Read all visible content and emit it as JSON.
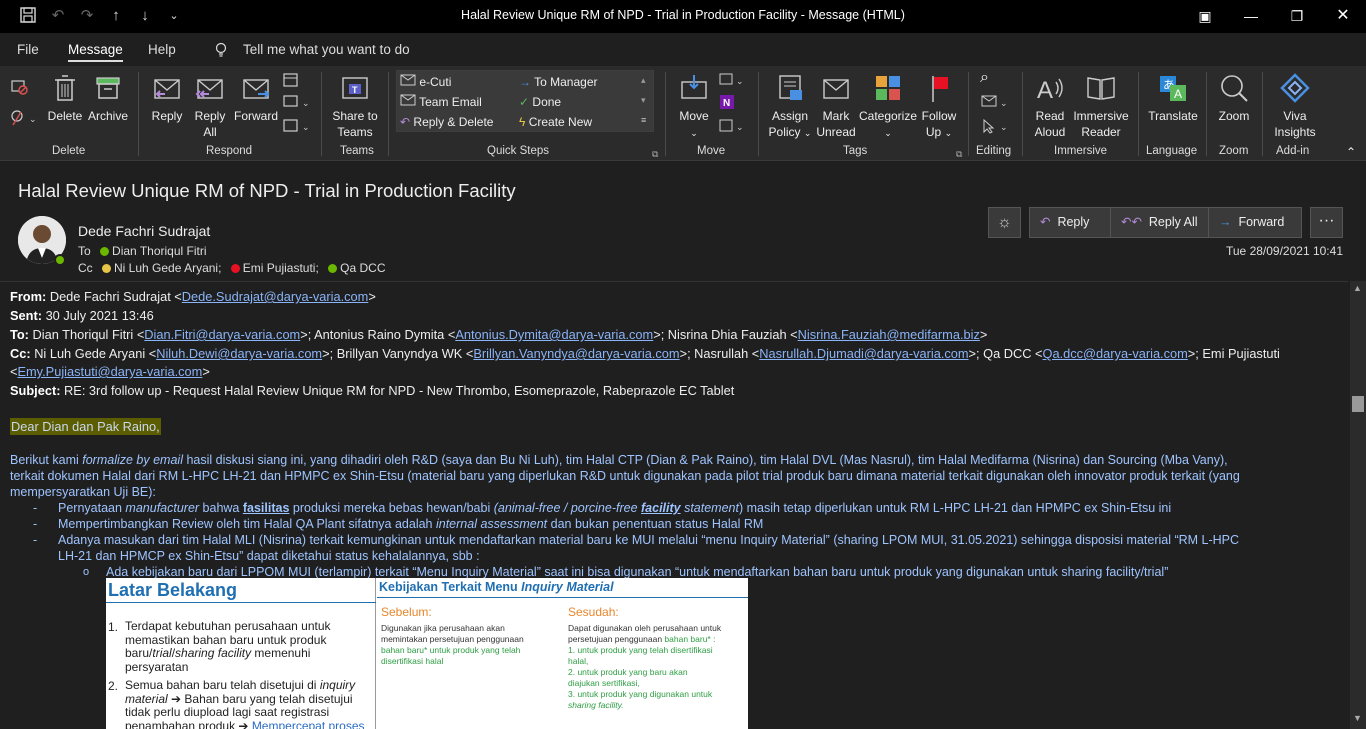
{
  "window": {
    "title": "Halal Review Unique RM of NPD - Trial in Production Facility  -  Message (HTML)"
  },
  "menu": {
    "file": "File",
    "message": "Message",
    "help": "Help",
    "tellme": "Tell me what you want to do"
  },
  "ribbon": {
    "delete_group": {
      "label": "Delete",
      "delete": "Delete",
      "archive": "Archive"
    },
    "respond_group": {
      "label": "Respond",
      "reply": "Reply",
      "reply_all_1": "Reply",
      "reply_all_2": "All",
      "forward": "Forward"
    },
    "teams_group": {
      "label": "Teams",
      "share_1": "Share to",
      "share_2": "Teams"
    },
    "quicksteps_group": {
      "label": "Quick Steps",
      "items": [
        "e-Cuti",
        "To Manager",
        "Team Email",
        "Done",
        "Reply & Delete",
        "Create New"
      ]
    },
    "move_group": {
      "label": "Move",
      "move": "Move"
    },
    "tags_group": {
      "label": "Tags",
      "assign_1": "Assign",
      "assign_2": "Policy",
      "mark_1": "Mark",
      "mark_2": "Unread",
      "categorize": "Categorize",
      "follow_1": "Follow",
      "follow_2": "Up"
    },
    "editing_group": {
      "label": "Editing"
    },
    "immersive_group": {
      "label": "Immersive",
      "read_1": "Read",
      "read_2": "Aloud",
      "reader_1": "Immersive",
      "reader_2": "Reader"
    },
    "language_group": {
      "label": "Language",
      "translate": "Translate"
    },
    "zoom_group": {
      "label": "Zoom",
      "zoom": "Zoom"
    },
    "addin_group": {
      "label": "Add-in",
      "viva_1": "Viva",
      "viva_2": "Insights"
    }
  },
  "message": {
    "subject": "Halal Review Unique RM of NPD - Trial in Production Facility",
    "sender": "Dede Fachri Sudrajat",
    "to_label": "To",
    "to": "Dian Thoriqul Fitri",
    "cc_label": "Cc",
    "cc": [
      "Ni Luh Gede Aryani;",
      "Emi Pujiastuti;",
      "Qa DCC"
    ],
    "date": "Tue 28/09/2021 10:41",
    "actions": {
      "reply": "Reply",
      "reply_all": "Reply All",
      "forward": "Forward"
    }
  },
  "body": {
    "from_label": "From:",
    "from_name": "Dede Fachri Sudrajat <",
    "from_email": "Dede.Sudrajat@darya-varia.com",
    "close": ">",
    "sent_label": "Sent:",
    "sent": "30 July 2021 13:46",
    "to_label": "To:",
    "to_1": "Dian Thoriqul Fitri <",
    "to_1e": "Dian.Fitri@darya-varia.com",
    "to_2": ">; Antonius Raino Dymita <",
    "to_2e": "Antonius.Dymita@darya-varia.com",
    "to_3": ">; Nisrina Dhia Fauziah <",
    "to_3e": "Nisrina.Fauziah@medifarma.biz",
    "cc_label": "Cc:",
    "cc_1": "Ni Luh Gede Aryani <",
    "cc_1e": "Niluh.Dewi@darya-varia.com",
    "cc_2": ">; Brillyan Vanyndya WK <",
    "cc_2e": "Brillyan.Vanyndya@darya-varia.com",
    "cc_3": ">; Nasrullah <",
    "cc_3e": "Nasrullah.Djumadi@darya-varia.com",
    "cc_4": ">; Qa DCC <",
    "cc_4e": "Qa.dcc@darya-varia.com",
    "cc_5": ">; Emi Pujiastuti",
    "cc_6": "<",
    "cc_6e": "Emy.Pujiastuti@darya-varia.com",
    "subject_label": "Subject:",
    "subject": "RE: 3rd follow up - Request Halal Review Unique RM for NPD - New Thrombo, Esomeprazole, Rabeprazole EC Tablet",
    "greeting": "Dear Dian dan Pak Raino,",
    "p1a": "Berikut kami ",
    "p1b": "formalize by email",
    "p1c": " hasil diskusi siang ini, yang dihadiri oleh R&D (saya dan Bu Ni Luh), tim Halal CTP (Dian & Pak Raino), tim Halal DVL (Mas Nasrul), tim Halal Medifarma (Nisrina) dan Sourcing (Mba Vany),",
    "p1d": "terkait dokumen Halal dari RM L-HPC LH-21 dan HPMPC ex Shin-Etsu (material baru yang diperlukan R&D untuk digunakan pada pilot trial produk baru dimana material terkait digunakan oleh innovator produk terkait (yang",
    "p1e": "mempersyaratkan Uji BE):",
    "b1a": "Pernyataan ",
    "b1b": "manufacturer",
    "b1c": " bahwa ",
    "b1d": "fasilitas",
    "b1e": " produksi mereka bebas hewan/babi ",
    "b1f": "(animal-free / porcine-free ",
    "b1g": "facility",
    "b1h": " statement",
    ")": ")",
    "b1i": " masih tetap diperlukan untuk RM L-HPC LH-21 dan HPMPC ex Shin-Etsu ini",
    "b2a": "Mempertimbangkan Review oleh tim Halal QA Plant sifatnya adalah ",
    "b2b": "internal assessment",
    "b2c": " dan bukan penentuan status Halal RM",
    "b3a": "Adanya masukan dari tim Halal MLI (Nisrina) terkait kemungkinan untuk mendaftarkan material baru ke MUI melalui “menu Inquiry Material” (sharing LPOM MUI, 31.05.2021) sehingga disposisi material “RM L-HPC",
    "b3b": "LH-21 dan HPMCP ex Shin-Etsu” dapat diketahui status kehalalannya, sbb :",
    "sub1": "Ada kebijakan baru dari LPPOM MUI (terlampir) terkait “Menu Inquiry Material” saat ini bisa digunakan “untuk mendaftarkan bahan baru untuk produk yang digunakan untuk sharing facility/trial”",
    "bullet_dash": "-",
    "bullet_o": "o"
  },
  "slide": {
    "left_title": "Latar Belakang",
    "l1a": "Terdapat kebutuhan perusahaan untuk",
    "l1b": "memastikan bahan baru untuk produk",
    "l1c": "baru/",
    "l1d": "trial",
    "l1e": "/",
    "l1f": "sharing facility",
    "l1g": " memenuhi",
    "l1h": "persyaratan",
    "l2a": "Semua bahan baru telah disetujui di ",
    "l2b": "inquiry",
    "l2c": "material",
    "l2d": " ➔ Bahan baru yang telah disetujui",
    "l2e": "tidak perlu diupload lagi saat registrasi",
    "l2f": "penambahan produk ➔ ",
    "l2g": "Mempercepat proses",
    "num1": "1.",
    "num2": "2.",
    "right_title_a": "Kebijakan Terkait Menu ",
    "right_title_b": "Inquiry Material",
    "before": "Sebelum:",
    "after": "Sesudah:",
    "b_1": "Digunakan jika perusahaan akan",
    "b_2": "memintakan persetujuan penggunaan",
    "b_3": "bahan baru* untuk produk yang telah",
    "b_4": "disertifikasi halal",
    "a_1": "Dapat digunakan oleh perusahaan untuk",
    "a_2": "persetujuan penggunaan ",
    "a_2b": "bahan baru* :",
    "a_3": "1. untuk produk yang telah disertifikasi",
    "a_4": "    halal,",
    "a_5": "2. untuk produk yang baru akan",
    "a_6": "    diajukan sertifikasi,",
    "a_7": "3. untuk produk yang digunakan untuk",
    "a_8": "sharing facility."
  },
  "colors": {
    "link": "#8ab4f8",
    "body_blue": "#9ec4ff",
    "highlight": "#6b6b00",
    "accent_blue": "#4a90e2"
  }
}
